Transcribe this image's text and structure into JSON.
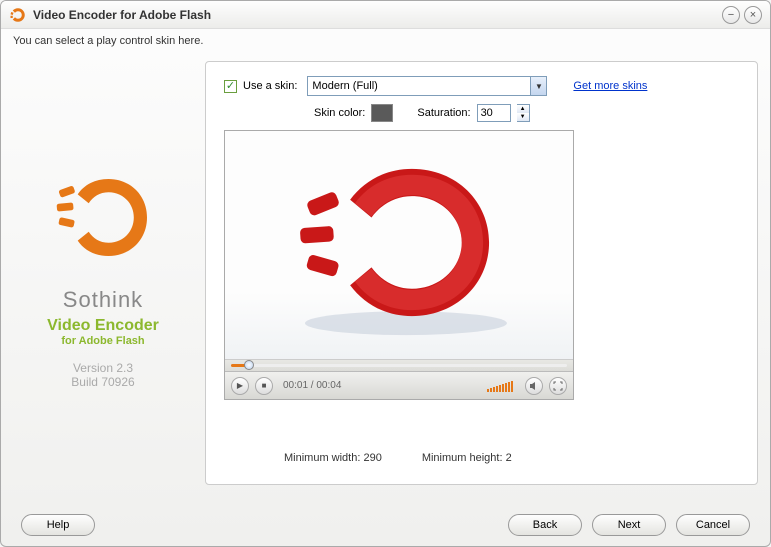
{
  "title": "Video Encoder for Adobe Flash",
  "hint": "You can select a play control skin here.",
  "brand": {
    "name": "Sothink",
    "sub1": "Video Encoder",
    "sub2": "for Adobe Flash",
    "version": "Version 2.3",
    "build": "Build 70926"
  },
  "skin": {
    "use_label": "Use a skin:",
    "selected": "Modern (Full)",
    "more_link": "Get more skins",
    "color_label": "Skin color:",
    "color_value": "#5a5a5a",
    "sat_label": "Saturation:",
    "sat_value": "30"
  },
  "player": {
    "time": "00:01 / 00:04"
  },
  "info": {
    "min_width_label": "Minimum width:",
    "min_width": "290",
    "min_height_label": "Minimum height:",
    "min_height": "2"
  },
  "buttons": {
    "help": "Help",
    "back": "Back",
    "next": "Next",
    "cancel": "Cancel"
  }
}
